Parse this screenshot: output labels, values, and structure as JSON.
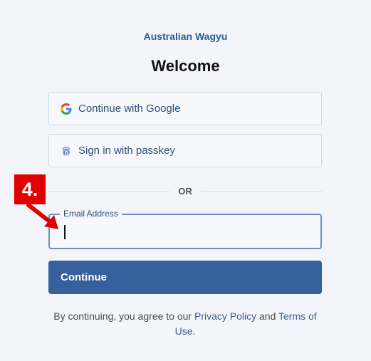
{
  "header": {
    "brand": "Australian Wagyu",
    "title": "Welcome"
  },
  "social": {
    "google_label": "Continue with Google",
    "google_icon": "google-g-icon",
    "passkey_label": "Sign in with passkey",
    "passkey_icon": "fingerprint-icon"
  },
  "divider": {
    "text": "OR"
  },
  "email": {
    "label": "Email Address",
    "value": ""
  },
  "continue_label": "Continue",
  "legal": {
    "prefix": "By continuing, you agree to our",
    "privacy": "Privacy Policy",
    "and": "and",
    "terms": "Terms of Use",
    "suffix": "."
  },
  "annotation": {
    "step": "4.",
    "color": "#e00000"
  },
  "colors": {
    "brand": "#2f5a94",
    "primary_button": "#365f9d",
    "focus_border": "#6f8fc4",
    "background": "#f4f5fa"
  }
}
